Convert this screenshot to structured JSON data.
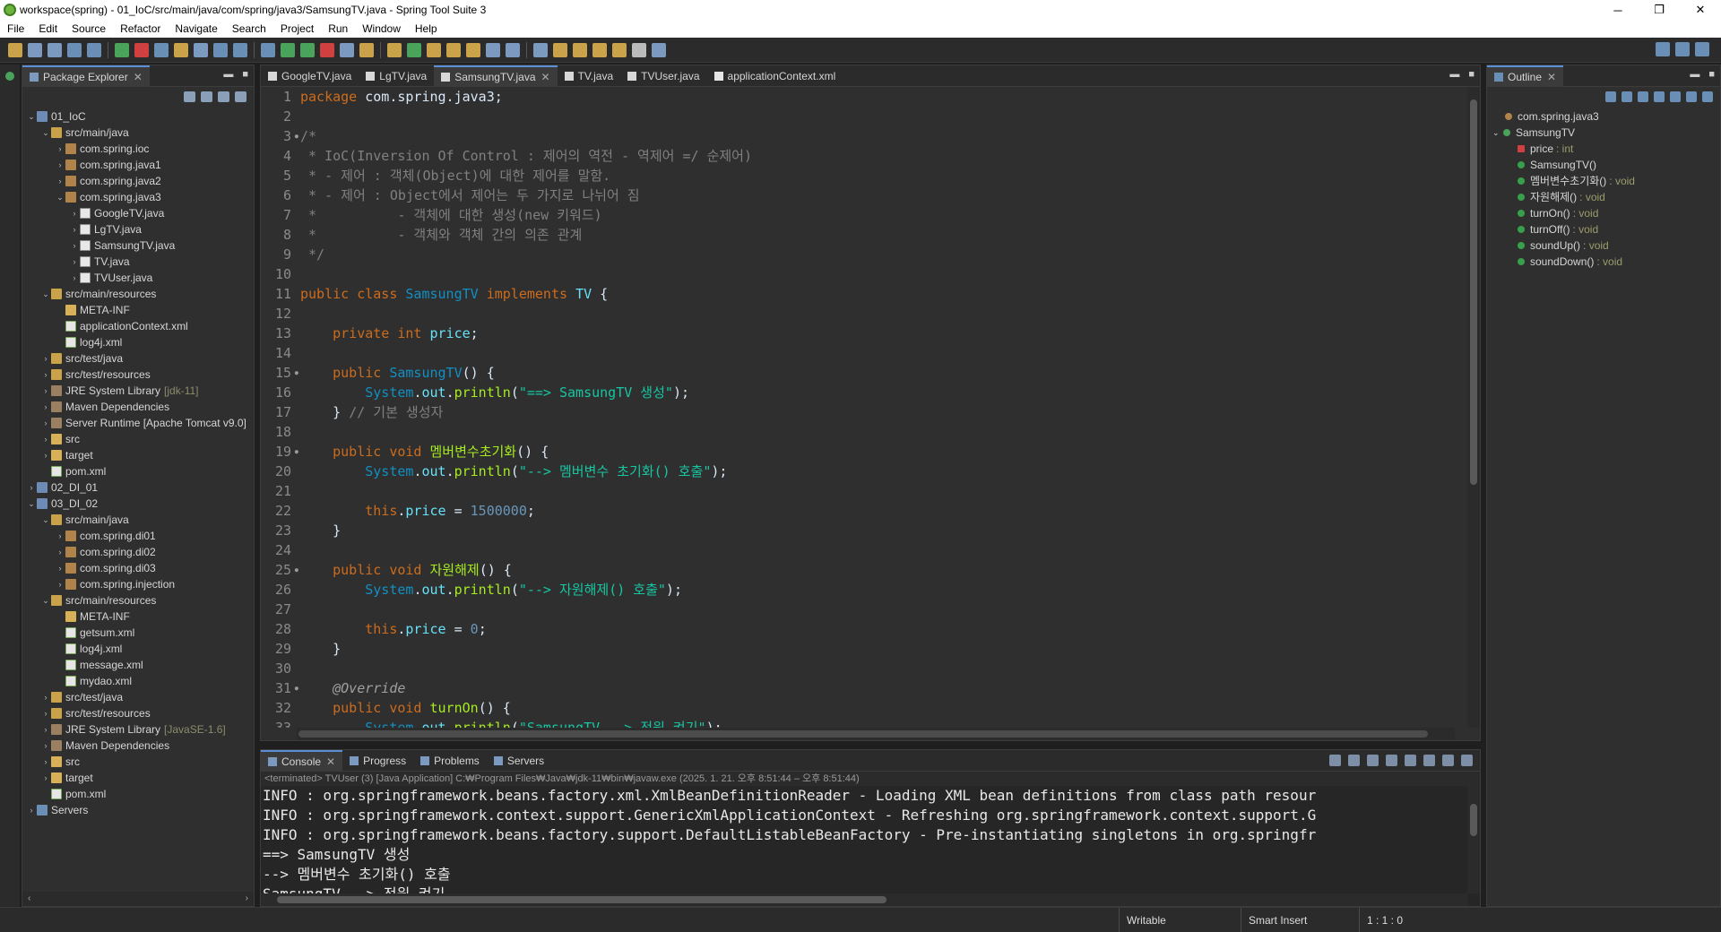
{
  "window": {
    "title": "workspace(spring) - 01_IoC/src/main/java/com/spring/java3/SamsungTV.java - Spring Tool Suite 3",
    "controls": {
      "minimize": "─",
      "restore": "❐",
      "close": "✕"
    }
  },
  "menu": [
    "File",
    "Edit",
    "Source",
    "Refactor",
    "Navigate",
    "Search",
    "Project",
    "Run",
    "Window",
    "Help"
  ],
  "package_explorer": {
    "title": "Package Explorer",
    "tree": [
      {
        "indent": 0,
        "arrow": "⌄",
        "icon": "project-icon",
        "label": "01_IoC",
        "suffix": ""
      },
      {
        "indent": 1,
        "arrow": "⌄",
        "icon": "source-folder-icon",
        "label": "src/main/java",
        "suffix": ""
      },
      {
        "indent": 2,
        "arrow": "›",
        "icon": "package-icon",
        "label": "com.spring.ioc",
        "suffix": ""
      },
      {
        "indent": 2,
        "arrow": "›",
        "icon": "package-icon",
        "label": "com.spring.java1",
        "suffix": ""
      },
      {
        "indent": 2,
        "arrow": "›",
        "icon": "package-icon",
        "label": "com.spring.java2",
        "suffix": ""
      },
      {
        "indent": 2,
        "arrow": "⌄",
        "icon": "package-icon",
        "label": "com.spring.java3",
        "suffix": ""
      },
      {
        "indent": 3,
        "arrow": "›",
        "icon": "java-file-icon",
        "label": "GoogleTV.java",
        "suffix": ""
      },
      {
        "indent": 3,
        "arrow": "›",
        "icon": "java-file-icon",
        "label": "LgTV.java",
        "suffix": ""
      },
      {
        "indent": 3,
        "arrow": "›",
        "icon": "java-file-icon",
        "label": "SamsungTV.java",
        "suffix": ""
      },
      {
        "indent": 3,
        "arrow": "›",
        "icon": "java-file-icon",
        "label": "TV.java",
        "suffix": ""
      },
      {
        "indent": 3,
        "arrow": "›",
        "icon": "java-file-icon",
        "label": "TVUser.java",
        "suffix": ""
      },
      {
        "indent": 1,
        "arrow": "⌄",
        "icon": "source-folder-icon",
        "label": "src/main/resources",
        "suffix": ""
      },
      {
        "indent": 2,
        "arrow": "",
        "icon": "folder-icon",
        "label": "META-INF",
        "suffix": ""
      },
      {
        "indent": 2,
        "arrow": "",
        "icon": "xml-file-icon",
        "label": "applicationContext.xml",
        "suffix": ""
      },
      {
        "indent": 2,
        "arrow": "",
        "icon": "xml-file-icon",
        "label": "log4j.xml",
        "suffix": ""
      },
      {
        "indent": 1,
        "arrow": "›",
        "icon": "source-folder-icon",
        "label": "src/test/java",
        "suffix": ""
      },
      {
        "indent": 1,
        "arrow": "›",
        "icon": "source-folder-icon",
        "label": "src/test/resources",
        "suffix": ""
      },
      {
        "indent": 1,
        "arrow": "›",
        "icon": "library-icon",
        "label": "JRE System Library",
        "suffix": "[jdk-11]"
      },
      {
        "indent": 1,
        "arrow": "›",
        "icon": "library-icon",
        "label": "Maven Dependencies",
        "suffix": ""
      },
      {
        "indent": 1,
        "arrow": "›",
        "icon": "library-icon",
        "label": "Server Runtime [Apache Tomcat v9.0]",
        "suffix": ""
      },
      {
        "indent": 1,
        "arrow": "›",
        "icon": "folder-icon",
        "label": "src",
        "suffix": ""
      },
      {
        "indent": 1,
        "arrow": "›",
        "icon": "folder-icon",
        "label": "target",
        "suffix": ""
      },
      {
        "indent": 1,
        "arrow": "",
        "icon": "xml-file-icon",
        "label": "pom.xml",
        "suffix": ""
      },
      {
        "indent": 0,
        "arrow": "›",
        "icon": "project-icon",
        "label": "02_DI_01",
        "suffix": ""
      },
      {
        "indent": 0,
        "arrow": "⌄",
        "icon": "project-icon",
        "label": "03_DI_02",
        "suffix": ""
      },
      {
        "indent": 1,
        "arrow": "⌄",
        "icon": "source-folder-icon",
        "label": "src/main/java",
        "suffix": ""
      },
      {
        "indent": 2,
        "arrow": "›",
        "icon": "package-icon",
        "label": "com.spring.di01",
        "suffix": ""
      },
      {
        "indent": 2,
        "arrow": "›",
        "icon": "package-icon",
        "label": "com.spring.di02",
        "suffix": ""
      },
      {
        "indent": 2,
        "arrow": "›",
        "icon": "package-icon",
        "label": "com.spring.di03",
        "suffix": ""
      },
      {
        "indent": 2,
        "arrow": "›",
        "icon": "package-icon",
        "label": "com.spring.injection",
        "suffix": ""
      },
      {
        "indent": 1,
        "arrow": "⌄",
        "icon": "source-folder-icon",
        "label": "src/main/resources",
        "suffix": ""
      },
      {
        "indent": 2,
        "arrow": "",
        "icon": "folder-icon",
        "label": "META-INF",
        "suffix": ""
      },
      {
        "indent": 2,
        "arrow": "",
        "icon": "xml-file-icon",
        "label": "getsum.xml",
        "suffix": ""
      },
      {
        "indent": 2,
        "arrow": "",
        "icon": "xml-file-icon",
        "label": "log4j.xml",
        "suffix": ""
      },
      {
        "indent": 2,
        "arrow": "",
        "icon": "xml-file-icon",
        "label": "message.xml",
        "suffix": ""
      },
      {
        "indent": 2,
        "arrow": "",
        "icon": "xml-file-icon",
        "label": "mydao.xml",
        "suffix": ""
      },
      {
        "indent": 1,
        "arrow": "›",
        "icon": "source-folder-icon",
        "label": "src/test/java",
        "suffix": ""
      },
      {
        "indent": 1,
        "arrow": "›",
        "icon": "source-folder-icon",
        "label": "src/test/resources",
        "suffix": ""
      },
      {
        "indent": 1,
        "arrow": "›",
        "icon": "library-icon",
        "label": "JRE System Library",
        "suffix": "[JavaSE-1.6]"
      },
      {
        "indent": 1,
        "arrow": "›",
        "icon": "library-icon",
        "label": "Maven Dependencies",
        "suffix": ""
      },
      {
        "indent": 1,
        "arrow": "›",
        "icon": "folder-icon",
        "label": "src",
        "suffix": ""
      },
      {
        "indent": 1,
        "arrow": "›",
        "icon": "folder-icon",
        "label": "target",
        "suffix": ""
      },
      {
        "indent": 1,
        "arrow": "",
        "icon": "xml-file-icon",
        "label": "pom.xml",
        "suffix": ""
      },
      {
        "indent": 0,
        "arrow": "›",
        "icon": "servers-icon",
        "label": "Servers",
        "suffix": ""
      }
    ]
  },
  "editor": {
    "tabs": [
      {
        "label": "GoogleTV.java",
        "active": false
      },
      {
        "label": "LgTV.java",
        "active": false
      },
      {
        "label": "SamsungTV.java",
        "active": true
      },
      {
        "label": "TV.java",
        "active": false
      },
      {
        "label": "TVUser.java",
        "active": false
      },
      {
        "label": "applicationContext.xml",
        "active": false
      }
    ],
    "line_numbers": [
      "1",
      "2",
      "3",
      "4",
      "5",
      "6",
      "7",
      "8",
      "9",
      "10",
      "11",
      "12",
      "13",
      "14",
      "15",
      "16",
      "17",
      "18",
      "19",
      "20",
      "21",
      "22",
      "23",
      "24",
      "25",
      "26",
      "27",
      "28",
      "29",
      "30",
      "31",
      "32",
      "33"
    ],
    "fold_markers": [
      "3",
      "15",
      "19",
      "25",
      "31"
    ],
    "lines": [
      [
        {
          "t": "kw",
          "v": "package"
        },
        {
          "t": "plain",
          "v": " com.spring.java3;"
        }
      ],
      [],
      [
        {
          "t": "cm",
          "v": "/*"
        }
      ],
      [
        {
          "t": "cm",
          "v": " * IoC(Inversion Of Control : 제어의 역전 - 역제어 =/ 순제어)"
        }
      ],
      [
        {
          "t": "cm",
          "v": " * - 제어 : 객체(Object)에 대한 제어를 말함."
        }
      ],
      [
        {
          "t": "cm",
          "v": " * - 제어 : Object에서 제어는 두 가지로 나뉘어 짐"
        }
      ],
      [
        {
          "t": "cm",
          "v": " *          - 객체에 대한 생성(new 키워드)"
        }
      ],
      [
        {
          "t": "cm",
          "v": " *          - 객체와 객체 간의 의존 관계"
        }
      ],
      [
        {
          "t": "cm",
          "v": " */"
        }
      ],
      [],
      [
        {
          "t": "kw",
          "v": "public"
        },
        {
          "t": "plain",
          "v": " "
        },
        {
          "t": "kw",
          "v": "class"
        },
        {
          "t": "plain",
          "v": " "
        },
        {
          "t": "ty",
          "v": "SamsungTV"
        },
        {
          "t": "plain",
          "v": " "
        },
        {
          "t": "kw",
          "v": "implements"
        },
        {
          "t": "plain",
          "v": " "
        },
        {
          "t": "fd",
          "v": "TV"
        },
        {
          "t": "plain",
          "v": " {"
        }
      ],
      [],
      [
        {
          "t": "plain",
          "v": "    "
        },
        {
          "t": "kw",
          "v": "private"
        },
        {
          "t": "plain",
          "v": " "
        },
        {
          "t": "kw",
          "v": "int"
        },
        {
          "t": "plain",
          "v": " "
        },
        {
          "t": "fd",
          "v": "price"
        },
        {
          "t": "plain",
          "v": ";"
        }
      ],
      [],
      [
        {
          "t": "plain",
          "v": "    "
        },
        {
          "t": "kw",
          "v": "public"
        },
        {
          "t": "plain",
          "v": " "
        },
        {
          "t": "ty",
          "v": "SamsungTV"
        },
        {
          "t": "plain",
          "v": "() {"
        }
      ],
      [
        {
          "t": "plain",
          "v": "        "
        },
        {
          "t": "ty",
          "v": "System"
        },
        {
          "t": "plain",
          "v": "."
        },
        {
          "t": "fd",
          "v": "out"
        },
        {
          "t": "plain",
          "v": "."
        },
        {
          "t": "meth",
          "v": "println"
        },
        {
          "t": "plain",
          "v": "("
        },
        {
          "t": "st",
          "v": "\"==> SamsungTV 생성\""
        },
        {
          "t": "plain",
          "v": ");"
        }
      ],
      [
        {
          "t": "plain",
          "v": "    } "
        },
        {
          "t": "cm",
          "v": "// 기본 생성자"
        }
      ],
      [],
      [
        {
          "t": "plain",
          "v": "    "
        },
        {
          "t": "kw",
          "v": "public"
        },
        {
          "t": "plain",
          "v": " "
        },
        {
          "t": "kw",
          "v": "void"
        },
        {
          "t": "plain",
          "v": " "
        },
        {
          "t": "meth",
          "v": "멤버변수초기화"
        },
        {
          "t": "plain",
          "v": "() {"
        }
      ],
      [
        {
          "t": "plain",
          "v": "        "
        },
        {
          "t": "ty",
          "v": "System"
        },
        {
          "t": "plain",
          "v": "."
        },
        {
          "t": "fd",
          "v": "out"
        },
        {
          "t": "plain",
          "v": "."
        },
        {
          "t": "meth",
          "v": "println"
        },
        {
          "t": "plain",
          "v": "("
        },
        {
          "t": "st",
          "v": "\"--> 멤버변수 초기화() 호출\""
        },
        {
          "t": "plain",
          "v": ");"
        }
      ],
      [],
      [
        {
          "t": "plain",
          "v": "        "
        },
        {
          "t": "kw",
          "v": "this"
        },
        {
          "t": "plain",
          "v": "."
        },
        {
          "t": "fd",
          "v": "price"
        },
        {
          "t": "plain",
          "v": " = "
        },
        {
          "t": "nm",
          "v": "1500000"
        },
        {
          "t": "plain",
          "v": ";"
        }
      ],
      [
        {
          "t": "plain",
          "v": "    }"
        }
      ],
      [],
      [
        {
          "t": "plain",
          "v": "    "
        },
        {
          "t": "kw",
          "v": "public"
        },
        {
          "t": "plain",
          "v": " "
        },
        {
          "t": "kw",
          "v": "void"
        },
        {
          "t": "plain",
          "v": " "
        },
        {
          "t": "meth",
          "v": "자원해제"
        },
        {
          "t": "plain",
          "v": "() {"
        }
      ],
      [
        {
          "t": "plain",
          "v": "        "
        },
        {
          "t": "ty",
          "v": "System"
        },
        {
          "t": "plain",
          "v": "."
        },
        {
          "t": "fd",
          "v": "out"
        },
        {
          "t": "plain",
          "v": "."
        },
        {
          "t": "meth",
          "v": "println"
        },
        {
          "t": "plain",
          "v": "("
        },
        {
          "t": "st",
          "v": "\"--> 자원해제() 호출\""
        },
        {
          "t": "plain",
          "v": ");"
        }
      ],
      [],
      [
        {
          "t": "plain",
          "v": "        "
        },
        {
          "t": "kw",
          "v": "this"
        },
        {
          "t": "plain",
          "v": "."
        },
        {
          "t": "fd",
          "v": "price"
        },
        {
          "t": "plain",
          "v": " = "
        },
        {
          "t": "nm",
          "v": "0"
        },
        {
          "t": "plain",
          "v": ";"
        }
      ],
      [
        {
          "t": "plain",
          "v": "    }"
        }
      ],
      [],
      [
        {
          "t": "plain",
          "v": "    "
        },
        {
          "t": "an",
          "v": "@Override"
        }
      ],
      [
        {
          "t": "plain",
          "v": "    "
        },
        {
          "t": "kw",
          "v": "public"
        },
        {
          "t": "plain",
          "v": " "
        },
        {
          "t": "kw",
          "v": "void"
        },
        {
          "t": "plain",
          "v": " "
        },
        {
          "t": "meth",
          "v": "turnOn"
        },
        {
          "t": "plain",
          "v": "() {"
        }
      ],
      [
        {
          "t": "plain",
          "v": "        "
        },
        {
          "t": "ty",
          "v": "System"
        },
        {
          "t": "plain",
          "v": "."
        },
        {
          "t": "fd",
          "v": "out"
        },
        {
          "t": "plain",
          "v": "."
        },
        {
          "t": "meth",
          "v": "println"
        },
        {
          "t": "plain",
          "v": "("
        },
        {
          "t": "st",
          "v": "\"SamsungTV --> 전원 켜기\""
        },
        {
          "t": "plain",
          "v": ");"
        }
      ]
    ]
  },
  "outline": {
    "title": "Outline",
    "items": [
      {
        "indent": 1,
        "icon": "package-decl-icon",
        "label": "com.spring.java3",
        "suffix": ""
      },
      {
        "indent": 0,
        "icon": "class-icon",
        "label": "SamsungTV",
        "suffix": "",
        "arrow": "⌄"
      },
      {
        "indent": 2,
        "icon": "private-field-icon",
        "label": "price",
        "suffix": ": int"
      },
      {
        "indent": 2,
        "icon": "constructor-icon",
        "label": "SamsungTV()",
        "suffix": ""
      },
      {
        "indent": 2,
        "icon": "method-icon",
        "label": "멤버변수초기화()",
        "suffix": ": void"
      },
      {
        "indent": 2,
        "icon": "method-icon",
        "label": "자원해제()",
        "suffix": ": void"
      },
      {
        "indent": 2,
        "icon": "override-method-icon",
        "label": "turnOn()",
        "suffix": ": void"
      },
      {
        "indent": 2,
        "icon": "override-method-icon",
        "label": "turnOff()",
        "suffix": ": void"
      },
      {
        "indent": 2,
        "icon": "override-method-icon",
        "label": "soundUp()",
        "suffix": ": void"
      },
      {
        "indent": 2,
        "icon": "override-method-icon",
        "label": "soundDown()",
        "suffix": ": void"
      }
    ]
  },
  "bottom": {
    "tabs": [
      {
        "label": "Console",
        "active": true
      },
      {
        "label": "Progress",
        "active": false
      },
      {
        "label": "Problems",
        "active": false
      },
      {
        "label": "Servers",
        "active": false
      }
    ],
    "meta": "<terminated> TVUser (3) [Java Application] C:₩Program Files₩Java₩jdk-11₩bin₩javaw.exe  (2025. 1. 21. 오후 8:51:44 – 오후 8:51:44)",
    "lines": [
      "INFO : org.springframework.beans.factory.xml.XmlBeanDefinitionReader - Loading XML bean definitions from class path resour",
      "INFO : org.springframework.context.support.GenericXmlApplicationContext - Refreshing org.springframework.context.support.G",
      "INFO : org.springframework.beans.factory.support.DefaultListableBeanFactory - Pre-instantiating singletons in org.springfr",
      "==> SamsungTV 생성",
      "--> 멤버변수 초기화() 호출",
      "SamsungTV --> 전원 켜기"
    ]
  },
  "status": {
    "writable": "Writable",
    "insert_mode": "Smart Insert",
    "position": "1 : 1 : 0"
  }
}
